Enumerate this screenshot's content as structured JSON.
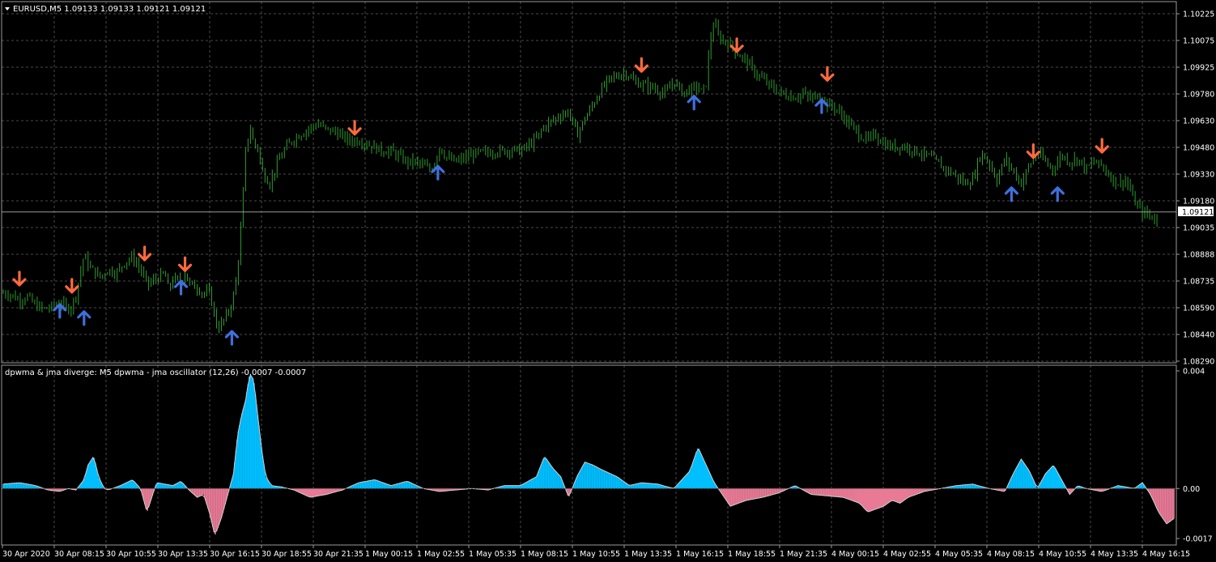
{
  "chart": {
    "header": "EURUSD,M5  1.09133 1.09133 1.09121 1.09121",
    "current_price": "1.09121",
    "price_labels": [
      "1.10225",
      "1.10075",
      "1.09925",
      "1.09780",
      "1.09630",
      "1.09480",
      "1.09330",
      "1.09180",
      "1.09035",
      "1.08888",
      "1.08735",
      "1.08590",
      "1.08440",
      "1.08290"
    ],
    "time_labels": [
      "30 Apr 2020",
      "30 Apr 08:15",
      "30 Apr 10:55",
      "30 Apr 13:35",
      "30 Apr 16:15",
      "30 Apr 18:55",
      "30 Apr 21:35",
      "1 May 00:15",
      "1 May 02:55",
      "1 May 05:35",
      "1 May 08:15",
      "1 May 10:55",
      "1 May 13:35",
      "1 May 16:15",
      "1 May 18:55",
      "1 May 21:35",
      "4 May 00:15",
      "4 May 02:55",
      "4 May 05:35",
      "4 May 08:15",
      "4 May 10:55",
      "4 May 13:35",
      "4 May 16:15"
    ],
    "colors": {
      "candle": "#2e9e2e",
      "up_arrow": "#3f6fdc",
      "down_arrow": "#ff6a3d",
      "osc_pos": "#00bfff",
      "osc_neg": "#e87a96",
      "grid": "#4a4a4a"
    }
  },
  "indicator": {
    "header": "dpwma & jma diverge: M5   dpwma - jma oscillator (12,26) -0.0007 -0.0007",
    "labels": [
      "0.004",
      "0.00",
      "-0.0017"
    ]
  },
  "chart_data": {
    "type": "line",
    "symbol": "EURUSD",
    "timeframe": "M5",
    "ylim": [
      1.0829,
      1.1025
    ],
    "x": [
      0,
      10,
      20,
      30,
      40,
      50,
      60,
      70,
      80,
      85,
      90,
      100,
      105,
      110,
      120,
      130,
      140,
      150,
      160,
      170,
      175,
      180,
      190,
      200,
      205,
      210,
      220,
      225,
      230,
      240,
      250,
      255,
      258,
      262,
      265,
      270,
      275,
      280,
      285,
      290,
      295,
      300,
      305,
      310,
      315,
      320,
      330,
      340,
      350,
      360,
      370,
      380,
      390,
      400,
      410,
      420,
      430,
      440,
      450,
      460,
      470,
      480,
      490,
      500,
      510,
      520,
      530,
      540,
      550,
      560,
      570,
      580,
      590,
      600,
      610,
      620,
      630,
      640,
      650,
      660,
      670,
      680,
      690,
      700,
      710,
      720,
      730,
      740,
      750,
      760,
      770,
      780,
      790,
      800,
      810,
      820,
      830,
      840,
      850,
      860,
      865,
      870,
      875,
      880,
      885,
      890,
      900,
      910,
      920,
      930,
      940,
      950,
      960,
      970,
      980,
      990,
      1000,
      1010,
      1020,
      1030,
      1040,
      1050,
      1060,
      1070,
      1080,
      1090,
      1100,
      1110,
      1120,
      1130,
      1140,
      1150,
      1160,
      1170,
      1180,
      1190,
      1200,
      1210,
      1220,
      1230,
      1240,
      1250,
      1260,
      1270,
      1280,
      1290,
      1300,
      1310,
      1320,
      1330,
      1340,
      1350,
      1360,
      1370,
      1380,
      1390,
      1400,
      1410,
      1420,
      1425,
      1430,
      1435,
      1440,
      1445,
      1450
    ],
    "close": [
      1.0867,
      1.0866,
      1.0863,
      1.0865,
      1.086,
      1.0858,
      1.0859,
      1.0862,
      1.0858,
      1.086,
      1.0866,
      1.0888,
      1.0883,
      1.088,
      1.0876,
      1.088,
      1.0878,
      1.0884,
      1.0887,
      1.088,
      1.0875,
      1.0872,
      1.0875,
      1.0878,
      1.0868,
      1.0875,
      1.0873,
      1.0879,
      1.0872,
      1.087,
      1.0866,
      1.0868,
      1.0862,
      1.0854,
      1.0847,
      1.085,
      1.0853,
      1.0858,
      1.0865,
      1.088,
      1.0908,
      1.0945,
      1.096,
      1.095,
      1.0948,
      1.0935,
      1.0928,
      1.094,
      1.0948,
      1.0953,
      1.0956,
      1.0959,
      1.0961,
      1.0958,
      1.0957,
      1.0954,
      1.0952,
      1.0952,
      1.095,
      1.0948,
      1.0946,
      1.0946,
      1.0943,
      1.094,
      1.094,
      1.0938,
      1.0935,
      1.0948,
      1.0942,
      1.094,
      1.0942,
      1.0944,
      1.0945,
      1.0945,
      1.0946,
      1.0946,
      1.0947,
      1.0946,
      1.0949,
      1.0953,
      1.096,
      1.0963,
      1.0966,
      1.0968,
      1.0955,
      1.0964,
      1.0972,
      1.098,
      1.0986,
      1.0988,
      1.099,
      1.0985,
      1.0983,
      1.0982,
      1.098,
      1.0978,
      1.0985,
      1.0979,
      1.098,
      1.0982,
      1.0978,
      1.0984,
      1.1008,
      1.1018,
      1.101,
      1.1008,
      1.1005,
      1.1,
      1.0996,
      1.099,
      1.0986,
      1.0982,
      1.0979,
      1.0977,
      1.0976,
      1.0978,
      1.0975,
      1.0978,
      1.0972,
      1.097,
      1.0965,
      1.096,
      1.0955,
      1.0952,
      1.0955,
      1.095,
      1.0948,
      1.0949,
      1.0948,
      1.0946,
      1.0944,
      1.0942,
      1.0938,
      1.0935,
      1.0932,
      1.0928,
      1.093,
      1.0945,
      1.094,
      1.093,
      1.0942,
      1.0935,
      1.0928,
      1.0938,
      1.0945,
      1.094,
      1.0936,
      1.0944,
      1.094,
      1.0942,
      1.0936,
      1.094,
      1.0938,
      1.0932,
      1.0928,
      1.093,
      1.0918,
      1.0912,
      1.091,
      1.0908,
      1.0907
    ],
    "signals_buy": [
      [
        70,
        1.0857
      ],
      [
        100,
        1.0853
      ],
      [
        220,
        1.087
      ],
      [
        283,
        1.0842
      ],
      [
        538,
        1.0934
      ],
      [
        855,
        1.0973
      ],
      [
        1013,
        1.0971
      ],
      [
        1248,
        1.0922
      ],
      [
        1305,
        1.0922
      ]
    ],
    "signals_sell": [
      [
        20,
        1.0875
      ],
      [
        85,
        1.0871
      ],
      [
        175,
        1.0889
      ],
      [
        225,
        1.0883
      ],
      [
        435,
        1.0959
      ],
      [
        790,
        1.0994
      ],
      [
        908,
        1.1005
      ],
      [
        1020,
        1.0989
      ],
      [
        1275,
        1.0946
      ],
      [
        1360,
        1.0949
      ]
    ],
    "oscillator": {
      "ylim": [
        -0.0017,
        0.004
      ],
      "x": [
        0,
        20,
        40,
        55,
        70,
        80,
        90,
        100,
        105,
        112,
        118,
        125,
        130,
        145,
        160,
        170,
        178,
        185,
        190,
        200,
        210,
        220,
        230,
        240,
        248,
        255,
        262,
        270,
        278,
        285,
        290,
        295,
        300,
        305,
        310,
        315,
        320,
        325,
        332,
        345,
        360,
        380,
        400,
        420,
        440,
        460,
        480,
        500,
        520,
        540,
        560,
        580,
        600,
        620,
        640,
        660,
        670,
        680,
        690,
        700,
        710,
        720,
        730,
        740,
        760,
        775,
        790,
        810,
        830,
        850,
        860,
        870,
        880,
        890,
        900,
        920,
        940,
        960,
        980,
        1000,
        1020,
        1040,
        1060,
        1070,
        1080,
        1090,
        1100,
        1110,
        1120,
        1140,
        1160,
        1180,
        1200,
        1220,
        1240,
        1250,
        1260,
        1270,
        1280,
        1290,
        1300,
        1310,
        1320,
        1330,
        1340,
        1360,
        1380,
        1400,
        1410,
        1420,
        1430,
        1440,
        1450
      ],
      "values": [
        0.00015,
        0.0002,
        0.0001,
        -5e-05,
        -0.0001,
        0.0,
        -5e-05,
        0.0003,
        0.0008,
        0.0011,
        0.0004,
        0.0,
        -5e-05,
        0.0001,
        0.0003,
        0.0,
        -0.0008,
        -0.0002,
        0.0002,
        0.00015,
        0.0001,
        0.00025,
        -5e-05,
        -0.0003,
        -0.0002,
        -0.0008,
        -0.0016,
        -0.001,
        -0.0002,
        0.0005,
        0.0018,
        0.0025,
        0.003,
        0.0039,
        0.0037,
        0.0025,
        0.0013,
        0.0004,
        0.0001,
        5e-05,
        -5e-05,
        -0.0003,
        -0.0002,
        -5e-05,
        0.0002,
        0.0003,
        0.0001,
        0.00025,
        0.0,
        -0.0001,
        -5e-05,
        0.0,
        -5e-05,
        0.0001,
        0.0001,
        0.0004,
        0.0011,
        0.0007,
        0.0004,
        -0.0003,
        0.0004,
        0.0009,
        0.0008,
        0.00065,
        0.0004,
        0.0001,
        0.0002,
        0.00015,
        0.0,
        0.0006,
        0.0014,
        0.0008,
        0.0002,
        -0.0002,
        -0.0006,
        -0.0004,
        -0.0003,
        -0.00015,
        0.0001,
        -0.0002,
        -0.00025,
        -0.0003,
        -0.0005,
        -0.0008,
        -0.0007,
        -0.0006,
        -0.0004,
        -0.0005,
        -0.0003,
        -0.0001,
        0.0,
        0.0001,
        0.00015,
        0.0,
        -0.0001,
        0.0005,
        0.001,
        0.0006,
        0.0,
        0.0005,
        0.0008,
        0.0003,
        -0.0002,
        0.0001,
        0.0,
        -0.0001,
        0.0001,
        0.0,
        0.0002,
        -0.0002,
        -0.0008,
        -0.0012,
        -0.001
      ]
    }
  }
}
